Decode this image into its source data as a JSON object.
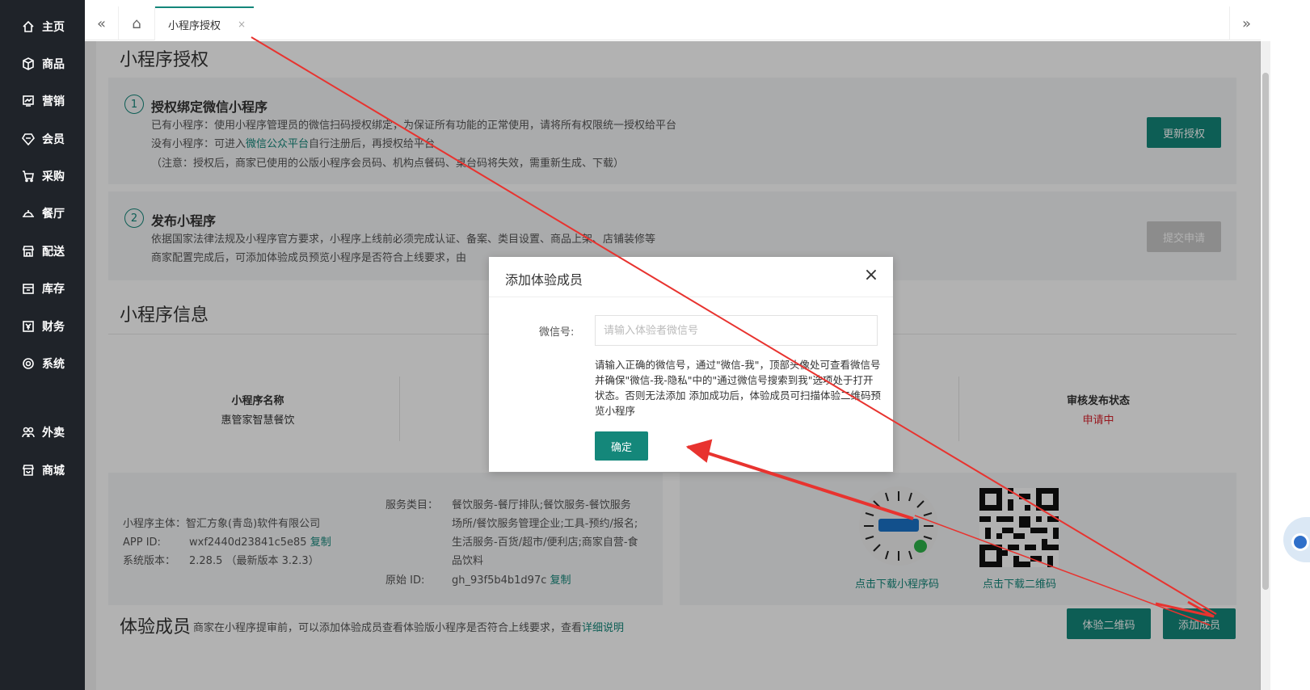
{
  "sidebar": {
    "items": [
      {
        "label": "主页",
        "icon": "home-icon"
      },
      {
        "label": "商品",
        "icon": "cube-icon"
      },
      {
        "label": "营销",
        "icon": "chart-icon"
      },
      {
        "label": "会员",
        "icon": "diamond-icon"
      },
      {
        "label": "采购",
        "icon": "cart-icon"
      },
      {
        "label": "餐厅",
        "icon": "dish-icon"
      },
      {
        "label": "配送",
        "icon": "store-icon"
      },
      {
        "label": "库存",
        "icon": "box-icon"
      },
      {
        "label": "财务",
        "icon": "money-icon"
      },
      {
        "label": "系统",
        "icon": "gear-icon"
      },
      {
        "label": "外卖",
        "icon": "people-icon"
      },
      {
        "label": "商城",
        "icon": "shop-icon"
      }
    ]
  },
  "topbar": {
    "back_icon": "«",
    "home_icon": "⌂",
    "tab_label": "小程序授权",
    "tab_close": "×",
    "forward_icon": "»"
  },
  "page": {
    "title": "小程序授权",
    "step1": {
      "num": "1",
      "title": "授权绑定微信小程序",
      "line1": "已有小程序：使用小程序管理员的微信扫码授权绑定，为保证所有功能的正常使用，请将所有权限统一授权给平台",
      "line2_pre": "没有小程序：可进入",
      "line2_link": "微信公众平台",
      "line2_post": "自行注册后，再授权给平台",
      "line3": "（注意：授权后，商家已使用的公版小程序会员码、机构点餐码、桌台码将失效，需重新生成、下载）",
      "button": "更新授权"
    },
    "step2": {
      "num": "2",
      "title": "发布小程序",
      "line1": "依据国家法律法规及小程序官方要求，小程序上线前必须完成认证、备案、类目设置、商品上架、店铺装修等",
      "line2": "商家配置完成后，可添加体验成员预览小程序是否符合上线要求，由",
      "button": "提交申请"
    },
    "info_title": "小程序信息",
    "info": {
      "name_label": "小程序名称",
      "name_value": "惠管家智慧餐饮",
      "status_label": "审核发布状态",
      "status_value": "申请中"
    },
    "details": {
      "subject_label": "小程序主体：",
      "subject_value": "智汇方象(青岛)软件有限公司",
      "appid_label": "APP ID:",
      "appid_value": "wxf2440d23841c5e85",
      "appid_copy": "复制",
      "version_label": "系统版本：",
      "version_value": "2.28.5 （最新版本 3.2.3）",
      "category_label": "服务类目：",
      "category_value1": "餐饮服务-餐厅排队;餐饮服务-餐饮服务",
      "category_value2": "场所/餐饮服务管理企业;工具-预约/报名;",
      "category_value3": "生活服务-百货/超市/便利店;商家自营-食",
      "category_value4": "品饮料",
      "origin_label": "原始 ID:",
      "origin_value": "gh_93f5b4b1d97c",
      "origin_copy": "复制",
      "qr1_caption": "点击下载小程序码",
      "qr2_caption": "点击下载二维码"
    },
    "members": {
      "title": "体验成员",
      "desc": "商家在小程序提审前，可以添加体验成员查看体验版小程序是否符合上线要求，查看",
      "desc_link": "详细说明",
      "btn_qr": "体验二维码",
      "btn_add": "添加成员"
    }
  },
  "modal": {
    "title": "添加体验成员",
    "close": "×",
    "label": "微信号:",
    "placeholder": "请输入体验者微信号",
    "value": "",
    "tip": "请输入正确的微信号，通过\"微信-我\"，顶部头像处可查看微信号并确保\"微信-我-隐私\"中的\"通过微信号搜索到我\"选项处于打开状态。否则无法添加 添加成功后，体验成员可扫描体验二维码预览小程序",
    "ok": "确定"
  },
  "colors": {
    "accent": "#14877a",
    "sidebar_bg": "#1f2329",
    "annotation_arrow": "#e8332f",
    "status_pending": "#d9232d"
  }
}
